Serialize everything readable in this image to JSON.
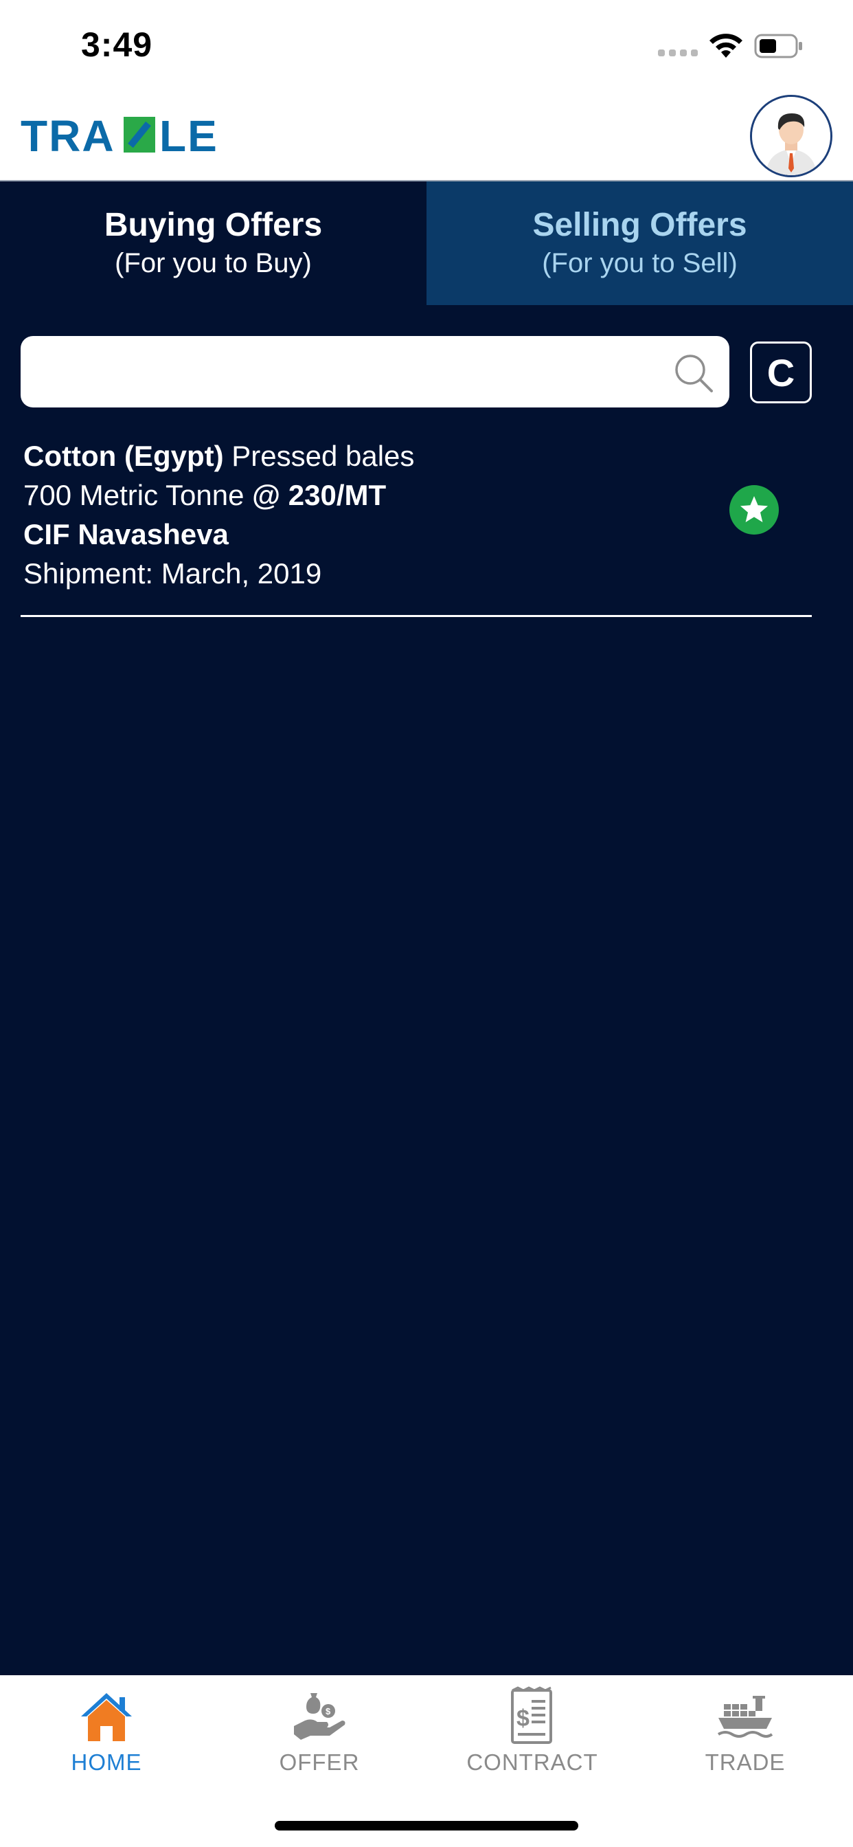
{
  "status_bar": {
    "time": "3:49",
    "icons": [
      "signal-dots-icon",
      "wifi-icon",
      "battery-icon"
    ]
  },
  "header": {
    "logo_text": "TRADLE",
    "avatar_icon": "user-avatar-icon"
  },
  "tabs": [
    {
      "title": "Buying Offers",
      "subtitle": "(For you to Buy)",
      "active": true
    },
    {
      "title": "Selling Offers",
      "subtitle": "(For you to Sell)",
      "active": false
    }
  ],
  "search": {
    "value": "",
    "placeholder": "",
    "icon": "search-icon",
    "c_button_label": "C"
  },
  "offers": [
    {
      "commodity": "Cotton (Egypt)",
      "packing": "Pressed bales",
      "quantity": "700",
      "unit": "Metric Tonne",
      "price_prefix": "@",
      "price": "230/MT",
      "incoterm": "CIF",
      "port": "Navasheva",
      "shipment_label": "Shipment:",
      "shipment_date": "March, 2019",
      "badge_icon": "star-icon"
    }
  ],
  "bottom_nav": [
    {
      "label": "HOME",
      "icon": "home-icon",
      "active": true
    },
    {
      "label": "OFFER",
      "icon": "offer-hand-money-icon",
      "active": false
    },
    {
      "label": "CONTRACT",
      "icon": "contract-document-icon",
      "active": false
    },
    {
      "label": "TRADE",
      "icon": "cargo-ship-icon",
      "active": false
    }
  ],
  "colors": {
    "background": "#021130",
    "tab_inactive": "#0b3a68",
    "tab_inactive_text": "#a9d4ef",
    "accent_blue": "#1e7fd4",
    "home_orange": "#f07c22",
    "star_green": "#1fa74a",
    "logo_blue": "#0b6aa8",
    "logo_green": "#2aa948"
  }
}
